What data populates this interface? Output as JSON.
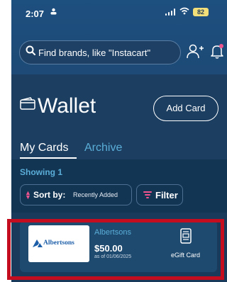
{
  "status_bar": {
    "time": "2:07",
    "battery": "82"
  },
  "search": {
    "placeholder": "Find brands, like \"Instacart\""
  },
  "wallet": {
    "title": "Wallet",
    "add_card_label": "Add Card"
  },
  "tabs": {
    "my_cards": "My Cards",
    "archive": "Archive"
  },
  "list": {
    "showing": "Showing 1",
    "sort_label": "Sort by:",
    "sort_value": "Recently Added",
    "filter_label": "Filter"
  },
  "cards": [
    {
      "logo_text": "Albertsons",
      "brand": "Albertsons",
      "amount": "$50.00",
      "as_of": "as of 01/06/2025",
      "type": "eGift Card",
      "icon": "gift-card-icon"
    }
  ],
  "colors": {
    "accent": "#5aaed8",
    "pink": "#f0548f",
    "highlight": "#c40d1e",
    "background": "#1a3a5c"
  }
}
